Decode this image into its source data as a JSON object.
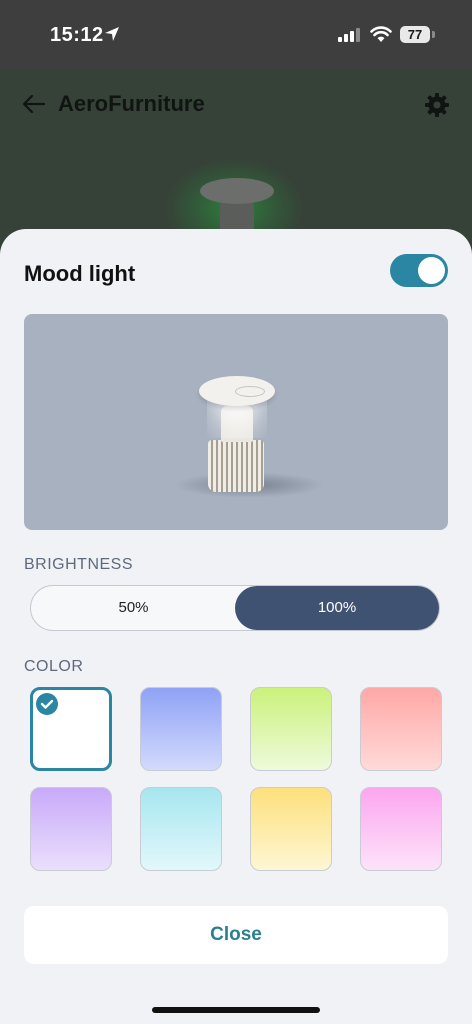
{
  "status_bar": {
    "time": "15:12",
    "battery": "77",
    "icons": [
      "location-arrow-icon",
      "cellular-signal-icon",
      "wifi-icon",
      "battery-icon"
    ]
  },
  "app": {
    "title": "AeroFurniture",
    "back_icon": "arrow-left-icon",
    "settings_icon": "gear-icon"
  },
  "sheet": {
    "title": "Mood light",
    "toggle_on": true,
    "accent": "#2b86a3",
    "brightness": {
      "label": "BRIGHTNESS",
      "options": [
        "50%",
        "100%"
      ],
      "selected": "100%",
      "selected_color": "#3f5272"
    },
    "color": {
      "label": "COLOR",
      "selected_index": 0,
      "swatches": [
        {
          "name": "white",
          "top": "#ffffff",
          "bottom": "#ffffff"
        },
        {
          "name": "blue",
          "top": "#8fa2f5",
          "bottom": "#d3dafd"
        },
        {
          "name": "green",
          "top": "#cbf27a",
          "bottom": "#eefadc"
        },
        {
          "name": "red",
          "top": "#ffa8a6",
          "bottom": "#ffdad8"
        },
        {
          "name": "purple",
          "top": "#c8aaf9",
          "bottom": "#eadffc"
        },
        {
          "name": "cyan",
          "top": "#a7e6ef",
          "bottom": "#e2f8fb"
        },
        {
          "name": "yellow",
          "top": "#fde07d",
          "bottom": "#fdf7d3"
        },
        {
          "name": "pink",
          "top": "#fca6ef",
          "bottom": "#fde3f9"
        }
      ]
    },
    "close_label": "Close"
  }
}
